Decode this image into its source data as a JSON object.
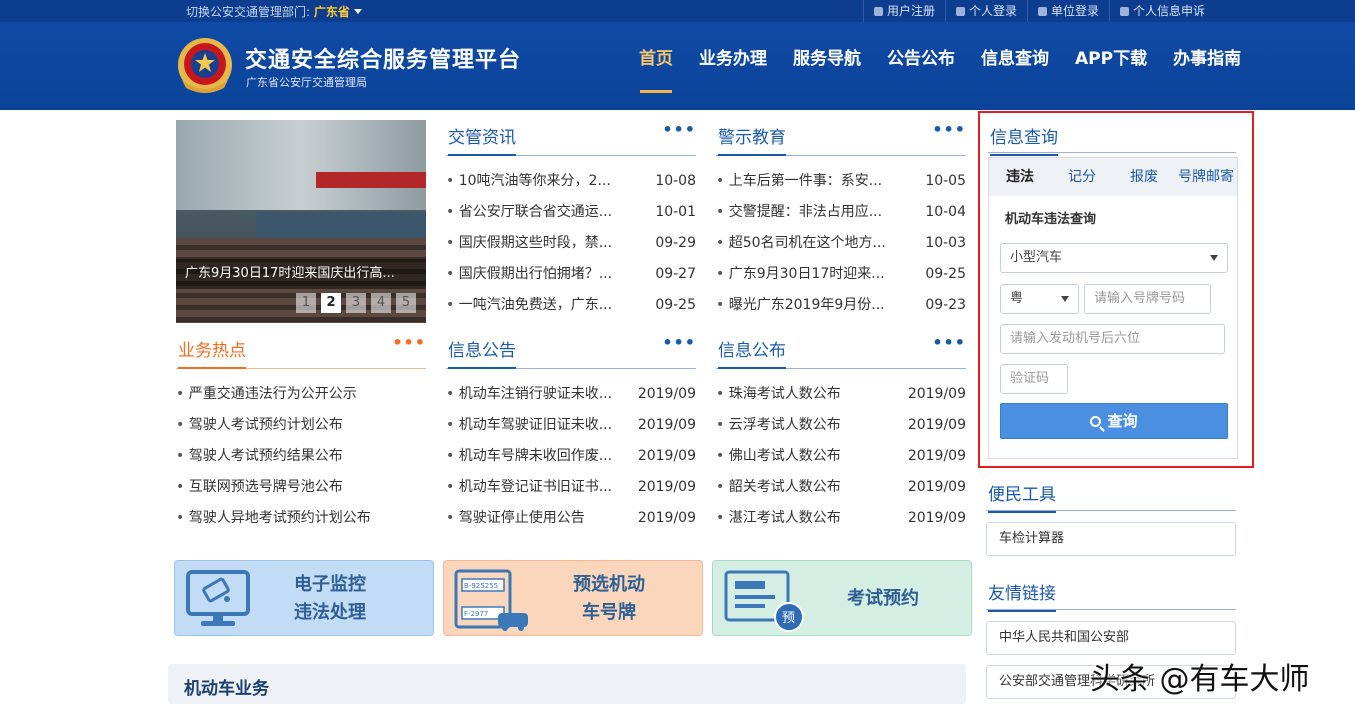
{
  "topbar": {
    "switch_label": "切换公安交通管理部门:",
    "province": "广东省",
    "links": [
      "用户注册",
      "个人登录",
      "单位登录",
      "个人信息申诉"
    ]
  },
  "header": {
    "title": "交通安全综合服务管理平台",
    "subtitle": "广东省公安厅交通管理局",
    "nav": [
      "首页",
      "业务办理",
      "服务导航",
      "公告公布",
      "信息查询",
      "APP下载",
      "办事指南"
    ]
  },
  "slider": {
    "caption": "广东9月30日17时迎来国庆出行高...",
    "pages": [
      "1",
      "2",
      "3",
      "4",
      "5"
    ]
  },
  "news": {
    "title": "交管资讯",
    "more": "•••",
    "items": [
      {
        "text": "10吨汽油等你来分，2...",
        "date": "10-08"
      },
      {
        "text": "省公安厅联合省交通运...",
        "date": "10-01"
      },
      {
        "text": "国庆假期这些时段，禁...",
        "date": "09-29"
      },
      {
        "text": "国庆假期出行怕拥堵？...",
        "date": "09-27"
      },
      {
        "text": "一吨汽油免费送，广东...",
        "date": "09-25"
      }
    ]
  },
  "warning": {
    "title": "警示教育",
    "more": "•••",
    "items": [
      {
        "text": "上车后第一件事：系安...",
        "date": "10-05"
      },
      {
        "text": "交警提醒：非法占用应...",
        "date": "10-04"
      },
      {
        "text": "超50名司机在这个地方...",
        "date": "10-03"
      },
      {
        "text": "广东9月30日17时迎来...",
        "date": "09-25"
      },
      {
        "text": "曝光广东2019年9月份...",
        "date": "09-23"
      }
    ]
  },
  "hot": {
    "title": "业务热点",
    "more": "•••",
    "items": [
      "严重交通违法行为公开公示",
      "驾驶人考试预约计划公布",
      "驾驶人考试预约结果公布",
      "互联网预选号牌号池公布",
      "驾驶人异地考试预约计划公布"
    ]
  },
  "notice": {
    "title": "信息公告",
    "more": "•••",
    "items": [
      {
        "text": "机动车注销行驶证未收...",
        "date": "2019/09"
      },
      {
        "text": "机动车驾驶证旧证未收...",
        "date": "2019/09"
      },
      {
        "text": "机动车号牌未收回作废...",
        "date": "2019/09"
      },
      {
        "text": "机动车登记证书旧证书...",
        "date": "2019/09"
      },
      {
        "text": "驾驶证停止使用公告",
        "date": "2019/09"
      }
    ]
  },
  "publish": {
    "title": "信息公布",
    "more": "•••",
    "items": [
      {
        "text": "珠海考试人数公布",
        "date": "2019/09"
      },
      {
        "text": "云浮考试人数公布",
        "date": "2019/09"
      },
      {
        "text": "佛山考试人数公布",
        "date": "2019/09"
      },
      {
        "text": "韶关考试人数公布",
        "date": "2019/09"
      },
      {
        "text": "湛江考试人数公布",
        "date": "2019/09"
      }
    ]
  },
  "query": {
    "title": "信息查询",
    "tabs": [
      "违法",
      "记分",
      "报废",
      "号牌邮寄"
    ],
    "form_title": "机动车违法查询",
    "vehicle_type": "小型汽车",
    "province_prefix": "粤",
    "plate_placeholder": "请输入号牌号码",
    "engine_placeholder": "请输入发动机号后六位",
    "captcha_placeholder": "验证码",
    "submit": "查询"
  },
  "tools": {
    "title": "便民工具",
    "items": [
      "车检计算器"
    ]
  },
  "links": {
    "title": "友情链接",
    "items": [
      "中华人民共和国公安部",
      "公安部交通管理科学研究所"
    ]
  },
  "tiles": [
    {
      "label": "电子监控\n违法处理"
    },
    {
      "label": "预选机动\n车号牌",
      "plate_top": "B-925255",
      "plate_bottom": "F-2977"
    },
    {
      "label": "考试预约",
      "badge": "预"
    }
  ],
  "motor_section": {
    "title": "机动车业务"
  },
  "watermark": "头条 @有车大师"
}
